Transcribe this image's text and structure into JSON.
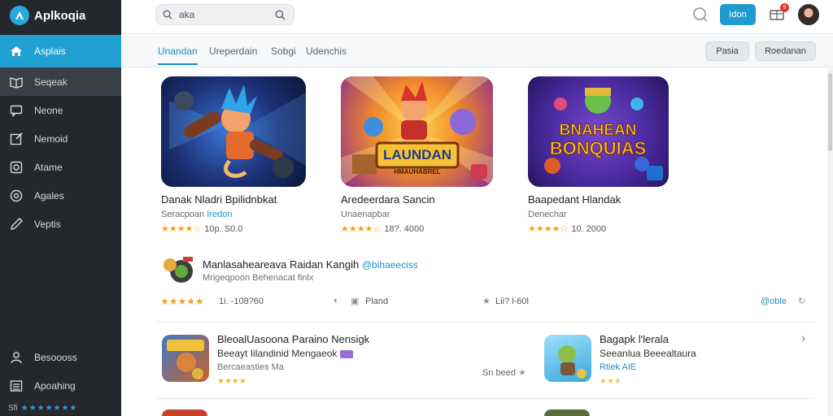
{
  "app": {
    "name": "Aplkoqia"
  },
  "sidebar": {
    "items": [
      {
        "label": "Asplais",
        "icon": "home-icon"
      },
      {
        "label": "Seqeak",
        "icon": "book-icon"
      },
      {
        "label": "Neone",
        "icon": "chat-icon"
      },
      {
        "label": "Nemoid",
        "icon": "edit-icon"
      },
      {
        "label": "Atame",
        "icon": "camera-icon"
      },
      {
        "label": "Agales",
        "icon": "palette-icon"
      },
      {
        "label": "Veptis",
        "icon": "pencil-icon"
      }
    ],
    "bottom": [
      {
        "label": "Besoooss",
        "icon": "user-icon"
      },
      {
        "label": "Apoahing",
        "icon": "list-icon"
      }
    ],
    "footer_rating": "Sfi"
  },
  "topbar": {
    "search_value": "aka",
    "primary_button": "Idon",
    "notification_count": "9"
  },
  "tabs": [
    {
      "label": "Unandan",
      "active": true
    },
    {
      "label": "Ureperdain",
      "active": false
    },
    {
      "label": "Sobgi",
      "active": false
    },
    {
      "label": "Udenchis",
      "active": false
    }
  ],
  "pills": [
    "Pasia",
    "Roedanan"
  ],
  "cards": [
    {
      "title": "Danak Nladri Bpilidnbkat",
      "sub_prefix": "Seracpoan",
      "sub_link": "Iredon",
      "rating": "10p. S0.0"
    },
    {
      "title": "Aredeerdara Sancin",
      "sub_prefix": "Unaenapbar",
      "sub_link": "",
      "rating": "18?. 4000"
    },
    {
      "title": "Baapedant Hlandak",
      "sub_prefix": "Denechar",
      "sub_link": "",
      "rating": "10. 2000"
    }
  ],
  "card_art": [
    {
      "caption": ""
    },
    {
      "caption": "LAUNDAN",
      "subcaption": "HMAUHABREL"
    },
    {
      "caption": "BNAHEAN",
      "subcaption": "BONQUIAS"
    }
  ],
  "feature": {
    "title": "Manlasaheareava Raidan Kangih",
    "handle": "@bihaeeciss",
    "sub": "Mrigeqpoon Behenacat finlx",
    "rating": "1i. -108?60",
    "action_1": "Pland",
    "action_2": "Lii? l-60l",
    "link": "@oble"
  },
  "rows": [
    {
      "title": "BleoalUasoona Paraino Nensigk",
      "sub": "Beeayt Iilandinid Mengaeok",
      "sub2": "Bercaeasties Ma",
      "meta": "Sn beed"
    },
    {
      "title": "Bagapk l'lerala",
      "sub": "Seeanlua Beeealtaura",
      "sub2": "Rtiek AIE",
      "meta": ""
    }
  ],
  "colors": {
    "accent": "#1f9bd1",
    "sidebar_bg": "#24272b",
    "star": "#f0a61f"
  }
}
